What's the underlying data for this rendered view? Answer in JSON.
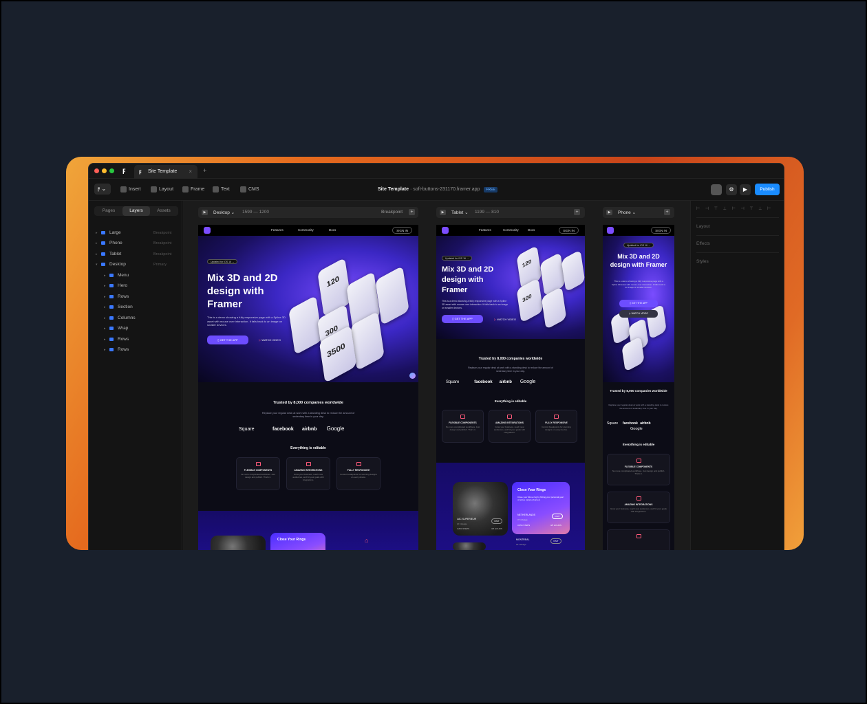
{
  "tab": {
    "title": "Site Template",
    "close": "×",
    "new": "+"
  },
  "toolbar": {
    "insert": "Insert",
    "layout": "Layout",
    "frame": "Frame",
    "text": "Text",
    "cms": "CMS",
    "site_title": "Site Template",
    "site_url": "· soft-buttons-231170.framer.app",
    "plan": "FREE",
    "publish": "Publish"
  },
  "left_panel": {
    "tabs": [
      "Pages",
      "Layers",
      "Assets"
    ],
    "layers": [
      {
        "name": "Large",
        "hint": "Breakpoint"
      },
      {
        "name": "Phone",
        "hint": "Breakpoint"
      },
      {
        "name": "Tablet",
        "hint": "Breakpoint"
      },
      {
        "name": "Desktop",
        "hint": "Primary"
      },
      {
        "name": "Menu",
        "hint": ""
      },
      {
        "name": "Hero",
        "hint": ""
      },
      {
        "name": "Rows",
        "hint": ""
      },
      {
        "name": "Section",
        "hint": ""
      },
      {
        "name": "Columns",
        "hint": ""
      },
      {
        "name": "Wrap",
        "hint": ""
      },
      {
        "name": "Rows",
        "hint": ""
      },
      {
        "name": "Rows",
        "hint": ""
      }
    ]
  },
  "right_panel": {
    "sections": [
      "Layout",
      "Effects",
      "Styles"
    ]
  },
  "frames": {
    "desktop": {
      "name": "Desktop ⌄",
      "size": "1599 — 1200",
      "breakpoint": "Breakpoint",
      "plus": "+"
    },
    "tablet": {
      "name": "Tablet ⌄",
      "size": "1199 — 810",
      "plus": "+"
    },
    "phone": {
      "name": "Phone ⌄",
      "plus": "+"
    }
  },
  "site": {
    "nav": {
      "features": "Features",
      "community": "Community",
      "docs": "Docs",
      "signin": "SIGN IN"
    },
    "badge": "Updated for iOS 16 →",
    "headline": "Mix 3D and 2D design with Framer",
    "description": "This is a demo showing a fully responsive page with a Spline 3D asset with mouse over interaction. It falls back to an image on smaller devices.",
    "cta_primary": "GET THE APP",
    "cta_secondary": "WATCH VIDEO",
    "phone_numbers": [
      "120",
      "300",
      "3500"
    ],
    "trusted": "Trusted by 8,000 companies worldwide",
    "trusted_sub": "Replace your regular desk at work with a standing desk to reduce the amount of sedentary time in your day.",
    "logos": [
      "Square",
      "facebook",
      "airbnb",
      "Google"
    ],
    "editable": "Everything is editable",
    "cards": [
      {
        "title": "FLEXIBLE COMPONENTS",
        "desc": "No more complicated workflows. Just design and publish. That's it."
      },
      {
        "title": "AMAZING INTEGRATIONS",
        "desc": "Grow your business, reach new audiences, and hit your goals with integrations."
      },
      {
        "title": "FULLY RESPONSIVE",
        "desc": "Control breakpoints for stunning designs on every device."
      }
    ],
    "rings_title": "Close Your Rings",
    "rings_desc": "Close your Move ring by hitting your personal goal of active calories burned.",
    "locations": [
      {
        "name": "LAC SUPERIEUR",
        "sub": "20 mileage",
        "steps": "3,654 STEPS",
        "hours": "3/5 HOURS",
        "action": "VISIT"
      },
      {
        "name": "NETHERLANDS",
        "sub": "37 mileage",
        "steps": "3,654 STEPS",
        "hours": "3/5 HOURS",
        "action": "VISIT"
      },
      {
        "name": "MONTREAL",
        "sub": "20 mileage",
        "action": "VISIT"
      }
    ]
  }
}
